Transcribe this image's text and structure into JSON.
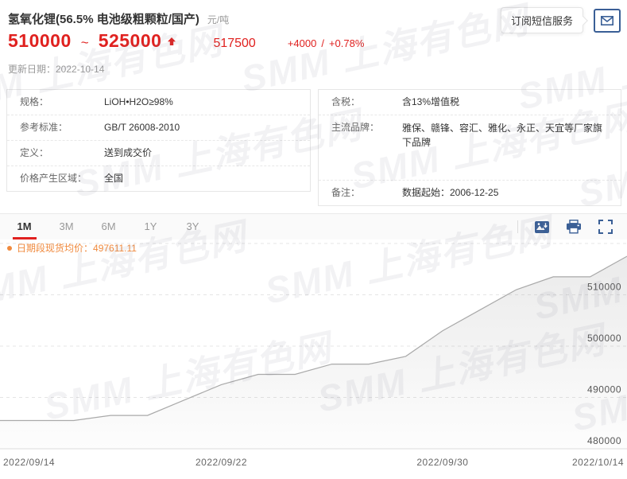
{
  "colors": {
    "accent_red": "#e0211f",
    "legend_orange": "#f08a3e",
    "icon_blue": "#3a5f96",
    "text_dark": "#333333",
    "text_muted": "#999999",
    "line_gray": "#a9a9a9"
  },
  "header": {
    "title": "氢氧化锂(56.5% 电池级粗颗粒/国产)",
    "unit": "元/吨",
    "price_low": "510000",
    "range_separator": "~",
    "price_high": "525000",
    "trend_icon": "up-arrow",
    "mid_price": "517500",
    "change_value": "+4000",
    "change_separator": "/",
    "change_percent": "+0.78%",
    "update_date": "更新日期：2022-10-14",
    "subscribe_button": "订阅短信服务",
    "envelope_icon": "envelope"
  },
  "info_left": {
    "rows": [
      {
        "label": "规格：",
        "value": "LiOH•H2O≥98%"
      },
      {
        "label": "参考标准：",
        "value": "GB/T 26008-2010"
      },
      {
        "label": "定义：",
        "value": "送到成交价"
      },
      {
        "label": "价格产生区域：",
        "value": "全国"
      }
    ]
  },
  "info_right": {
    "rows": [
      {
        "label": "含税：",
        "value": "含13%增值税"
      },
      {
        "label": "主流品牌：",
        "value": "雅保、赣锋、容汇、雅化、永正、天宜等厂家旗下品牌"
      },
      {
        "label": "备注：",
        "value": "数据起始：2006-12-25"
      }
    ]
  },
  "tabs": {
    "items": [
      {
        "label": "1M",
        "active": true
      },
      {
        "label": "3M",
        "active": false
      },
      {
        "label": "6M",
        "active": false
      },
      {
        "label": "1Y",
        "active": false
      },
      {
        "label": "3Y",
        "active": false
      }
    ]
  },
  "toolbar_icons": [
    "save-image",
    "print",
    "fullscreen"
  ],
  "legend": {
    "label": "日期段现货均价：",
    "value": "497611.11"
  },
  "watermark": {
    "text": "SMM 上海有色网"
  },
  "chart_data": {
    "type": "area",
    "series_name": "日期段现货均价",
    "average_shown": 497611.11,
    "x": [
      "2022/09/14",
      "2022/09/15",
      "2022/09/16",
      "2022/09/19",
      "2022/09/20",
      "2022/09/21",
      "2022/09/22",
      "2022/09/23",
      "2022/09/26",
      "2022/09/27",
      "2022/09/28",
      "2022/09/29",
      "2022/09/30",
      "2022/10/10",
      "2022/10/11",
      "2022/10/12",
      "2022/10/13",
      "2022/10/14"
    ],
    "values": [
      485500,
      485500,
      485500,
      486500,
      486500,
      489500,
      492500,
      494500,
      494500,
      496500,
      496500,
      498000,
      503000,
      507000,
      511000,
      513500,
      513500,
      517500
    ],
    "ylim": [
      480000,
      520000
    ],
    "y_ticks": [
      480000,
      490000,
      500000,
      510000
    ],
    "x_tick_labels": [
      "2022/09/14",
      "2022/09/22",
      "2022/09/30",
      "2022/10/14"
    ],
    "x_tick_indices": [
      0,
      6,
      12,
      17
    ],
    "grid": "dashed-horizontal",
    "legend_position": "top-left",
    "line_color": "#a9a9a9",
    "area_fill": "gray-gradient-top-to-transparent"
  }
}
